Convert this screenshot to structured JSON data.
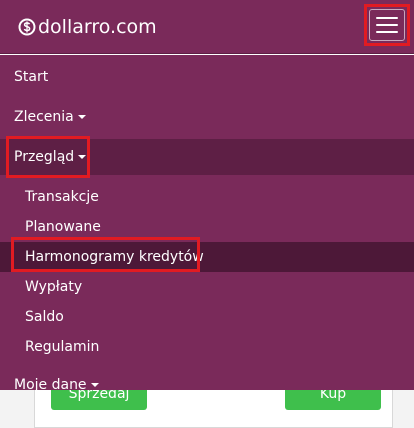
{
  "brand": {
    "name": "dollarro.com",
    "icon": "dollar-circle-icon"
  },
  "navbar": {
    "toggle_icon": "hamburger-menu-icon"
  },
  "menu": {
    "start": "Start",
    "zlecenia": "Zlecenia",
    "przeglad": "Przegląd",
    "submenu": [
      "Transakcje",
      "Planowane",
      "Harmonogramy kredytów",
      "Wypłaty",
      "Saldo",
      "Regulamin"
    ],
    "moje_dane": "Moje dane"
  },
  "content": {
    "sell_label": "Sprzedaj",
    "buy_label": "Kup"
  },
  "colors": {
    "menu_bg": "#7a2a5a",
    "highlight": "#e11b22",
    "button_green": "#3fbf4c"
  }
}
